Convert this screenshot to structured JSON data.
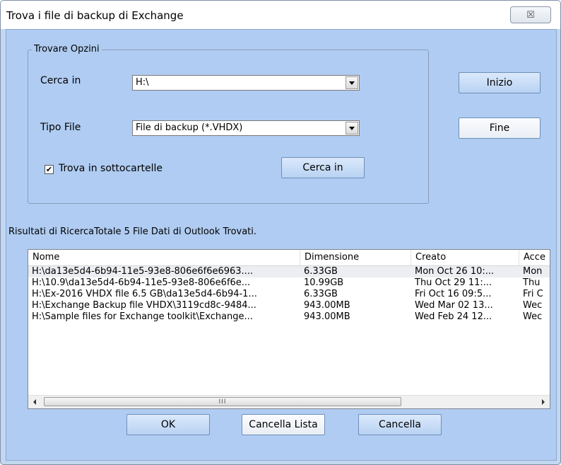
{
  "window": {
    "title": "Trova i file  di backup di Exchange",
    "close_label": "☒"
  },
  "options": {
    "group_label": "Trovare Opzini",
    "search_in_label": "Cerca in",
    "search_in_value": "H:\\",
    "file_type_label": "Tipo File",
    "file_type_value": "File di backup (*.VHDX)",
    "subfolders_label": "Trova in sottocartelle",
    "subfolders_checked": true,
    "browse_button": "Cerca in"
  },
  "actions": {
    "start_button": "Inizio",
    "stop_button": "Fine"
  },
  "results": {
    "summary": "Risultati di RicercaTotale 5 File Dati di Outlook Trovati.",
    "columns": [
      "Nome",
      "Dimensione",
      "Creato",
      "Acce"
    ],
    "rows": [
      [
        "H:\\da13e5d4-6b94-11e5-93e8-806e6f6e6963....",
        "6.33GB",
        "Mon Oct 26 10:...",
        "Mon"
      ],
      [
        "H:\\10.9\\da13e5d4-6b94-11e5-93e8-806e6f6e...",
        "10.99GB",
        "Thu Oct 29 11:...",
        "Thu"
      ],
      [
        "H:\\Ex-2016 VHDX file 6.5 GB\\da13e5d4-6b94-1...",
        "6.33GB",
        "Fri Oct 16 09:5...",
        "Fri C"
      ],
      [
        "H:\\Exchange Backup file VHDX\\3119cd8c-9484...",
        "943.00MB",
        "Wed Mar 02 13...",
        "Wec"
      ],
      [
        "H:\\Sample files  for Exchange toolkit\\Exchange...",
        "943.00MB",
        "Wed Feb 24 12...",
        "Wec"
      ]
    ],
    "scroll_grip": "III"
  },
  "footer": {
    "ok_button": "OK",
    "clear_list_button": "Cancella Lista",
    "cancel_button": "Cancella"
  }
}
